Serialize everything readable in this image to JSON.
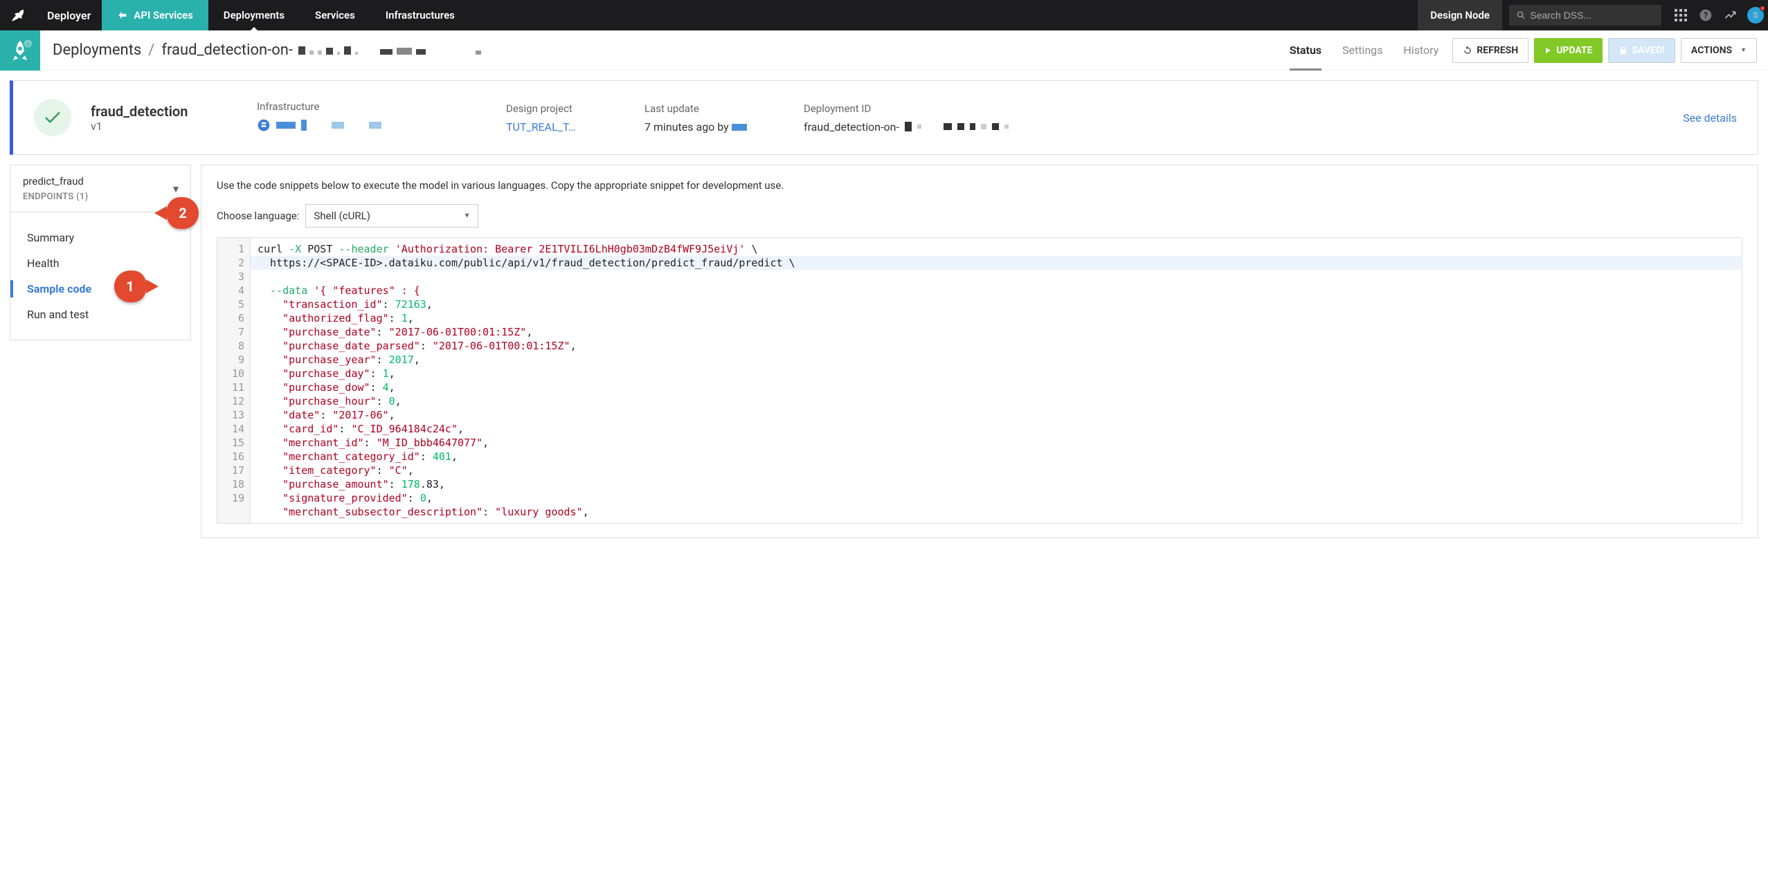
{
  "topnav": {
    "brand": "Deployer",
    "tabs": {
      "api_services": "API Services",
      "deployments": "Deployments",
      "services": "Services",
      "infrastructures": "Infrastructures"
    },
    "design_node": "Design Node",
    "search_placeholder": "Search DSS...",
    "avatar_letter": "S"
  },
  "breadcrumb": {
    "root": "Deployments",
    "current": "fraud_detection-on-"
  },
  "subheader_tabs": {
    "status": "Status",
    "settings": "Settings",
    "history": "History"
  },
  "buttons": {
    "refresh": "REFRESH",
    "update": "UPDATE",
    "saved": "SAVED!",
    "actions": "ACTIONS"
  },
  "status_card": {
    "name": "fraud_detection",
    "version": "v1",
    "infra_label": "Infrastructure",
    "design_project_label": "Design project",
    "design_project_value": "TUT_REAL_T…",
    "last_update_label": "Last update",
    "last_update_value": "7 minutes ago by",
    "deployment_id_label": "Deployment ID",
    "deployment_id_value": "fraud_detection-on-",
    "see_details": "See details"
  },
  "sidebar": {
    "endpoint": "predict_fraud",
    "endpoints_label": "ENDPOINTS (1)",
    "items": {
      "summary": "Summary",
      "health": "Health",
      "sample_code": "Sample code",
      "run_test": "Run and test"
    }
  },
  "main": {
    "intro": "Use the code snippets below to execute the model in various languages. Copy the appropriate snippet for development use.",
    "choose_language": "Choose language:",
    "language_selected": "Shell (cURL)"
  },
  "callouts": {
    "c1": "1",
    "c2": "2"
  },
  "code": {
    "line_count": 19,
    "lines": [
      [
        [
          "plain",
          "curl "
        ],
        [
          "flag",
          "-X"
        ],
        [
          "plain",
          " POST "
        ],
        [
          "flag",
          "--header"
        ],
        [
          "plain",
          " "
        ],
        [
          "str",
          "'Authorization: Bearer 2E1TVILI6LhH0gb03mDzB4fWF9J5eiVj'"
        ],
        [
          "plain",
          " \\"
        ]
      ],
      [
        [
          "plain",
          "  https://<SPACE-ID>.dataiku.com/public/api/v1/fraud_detection/predict_fraud/predict \\"
        ]
      ],
      [
        [
          "flag",
          "  --data"
        ],
        [
          "plain",
          " "
        ],
        [
          "str",
          "'{ \"features\" : {"
        ]
      ],
      [
        [
          "plain",
          "    "
        ],
        [
          "key",
          "\"transaction_id\""
        ],
        [
          "plain",
          ": "
        ],
        [
          "num",
          "72163"
        ],
        [
          "plain",
          ","
        ]
      ],
      [
        [
          "plain",
          "    "
        ],
        [
          "key",
          "\"authorized_flag\""
        ],
        [
          "plain",
          ": "
        ],
        [
          "num",
          "1"
        ],
        [
          "plain",
          ","
        ]
      ],
      [
        [
          "plain",
          "    "
        ],
        [
          "key",
          "\"purchase_date\""
        ],
        [
          "plain",
          ": "
        ],
        [
          "str",
          "\"2017-06-01T00:01:15Z\""
        ],
        [
          "plain",
          ","
        ]
      ],
      [
        [
          "plain",
          "    "
        ],
        [
          "key",
          "\"purchase_date_parsed\""
        ],
        [
          "plain",
          ": "
        ],
        [
          "str",
          "\"2017-06-01T00:01:15Z\""
        ],
        [
          "plain",
          ","
        ]
      ],
      [
        [
          "plain",
          "    "
        ],
        [
          "key",
          "\"purchase_year\""
        ],
        [
          "plain",
          ": "
        ],
        [
          "num",
          "2017"
        ],
        [
          "plain",
          ","
        ]
      ],
      [
        [
          "plain",
          "    "
        ],
        [
          "key",
          "\"purchase_day\""
        ],
        [
          "plain",
          ": "
        ],
        [
          "num",
          "1"
        ],
        [
          "plain",
          ","
        ]
      ],
      [
        [
          "plain",
          "    "
        ],
        [
          "key",
          "\"purchase_dow\""
        ],
        [
          "plain",
          ": "
        ],
        [
          "num",
          "4"
        ],
        [
          "plain",
          ","
        ]
      ],
      [
        [
          "plain",
          "    "
        ],
        [
          "key",
          "\"purchase_hour\""
        ],
        [
          "plain",
          ": "
        ],
        [
          "num",
          "0"
        ],
        [
          "plain",
          ","
        ]
      ],
      [
        [
          "plain",
          "    "
        ],
        [
          "key",
          "\"date\""
        ],
        [
          "plain",
          ": "
        ],
        [
          "str",
          "\"2017-06\""
        ],
        [
          "plain",
          ","
        ]
      ],
      [
        [
          "plain",
          "    "
        ],
        [
          "key",
          "\"card_id\""
        ],
        [
          "plain",
          ": "
        ],
        [
          "str",
          "\"C_ID_964184c24c\""
        ],
        [
          "plain",
          ","
        ]
      ],
      [
        [
          "plain",
          "    "
        ],
        [
          "key",
          "\"merchant_id\""
        ],
        [
          "plain",
          ": "
        ],
        [
          "str",
          "\"M_ID_bbb4647077\""
        ],
        [
          "plain",
          ","
        ]
      ],
      [
        [
          "plain",
          "    "
        ],
        [
          "key",
          "\"merchant_category_id\""
        ],
        [
          "plain",
          ": "
        ],
        [
          "num",
          "401"
        ],
        [
          "plain",
          ","
        ]
      ],
      [
        [
          "plain",
          "    "
        ],
        [
          "key",
          "\"item_category\""
        ],
        [
          "plain",
          ": "
        ],
        [
          "str",
          "\"C\""
        ],
        [
          "plain",
          ","
        ]
      ],
      [
        [
          "plain",
          "    "
        ],
        [
          "key",
          "\"purchase_amount\""
        ],
        [
          "plain",
          ": "
        ],
        [
          "num",
          "178"
        ],
        [
          "plain",
          ".83,"
        ]
      ],
      [
        [
          "plain",
          "    "
        ],
        [
          "key",
          "\"signature_provided\""
        ],
        [
          "plain",
          ": "
        ],
        [
          "num",
          "0"
        ],
        [
          "plain",
          ","
        ]
      ],
      [
        [
          "plain",
          "    "
        ],
        [
          "key",
          "\"merchant_subsector_description\""
        ],
        [
          "plain",
          ": "
        ],
        [
          "str",
          "\"luxury goods\""
        ],
        [
          "plain",
          ","
        ]
      ]
    ]
  }
}
